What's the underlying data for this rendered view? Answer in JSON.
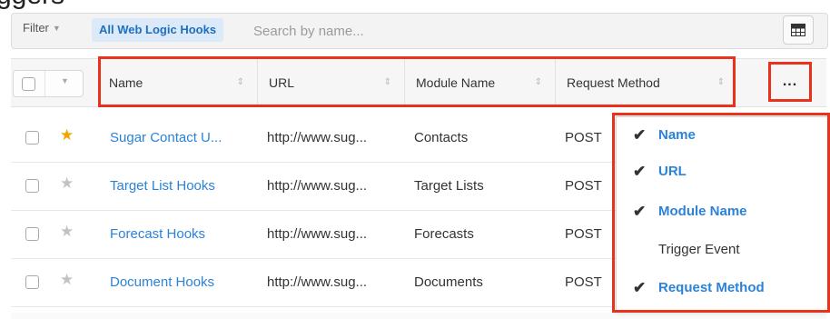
{
  "heading": {
    "partial_text": "ggers"
  },
  "filterbar": {
    "filter_label": "Filter",
    "active_filter": "All Web Logic Hooks",
    "search_placeholder": "Search by name...",
    "toggle_icon": "grid-icon"
  },
  "table": {
    "columns": [
      {
        "label": "Name"
      },
      {
        "label": "URL"
      },
      {
        "label": "Module Name"
      },
      {
        "label": "Request Method"
      }
    ],
    "more_label": "...",
    "rows": [
      {
        "favorite": true,
        "name": "Sugar Contact U...",
        "url": "http://www.sug...",
        "module": "Contacts",
        "method": "POST"
      },
      {
        "favorite": false,
        "name": "Target List Hooks",
        "url": "http://www.sug...",
        "module": "Target Lists",
        "method": "POST"
      },
      {
        "favorite": false,
        "name": "Forecast Hooks",
        "url": "http://www.sug...",
        "module": "Forecasts",
        "method": "POST"
      },
      {
        "favorite": false,
        "name": "Document Hooks",
        "url": "http://www.sug...",
        "module": "Documents",
        "method": "POST"
      }
    ]
  },
  "column_menu": {
    "items": [
      {
        "label": "Name",
        "checked": true
      },
      {
        "label": "URL",
        "checked": true
      },
      {
        "label": "Module Name",
        "checked": true
      },
      {
        "label": "Trigger Event",
        "checked": false
      },
      {
        "label": "Request Method",
        "checked": true
      }
    ]
  },
  "colors": {
    "highlight_border": "#e8321b",
    "link": "#2b82d9",
    "favorite_star": "#f0a400"
  }
}
